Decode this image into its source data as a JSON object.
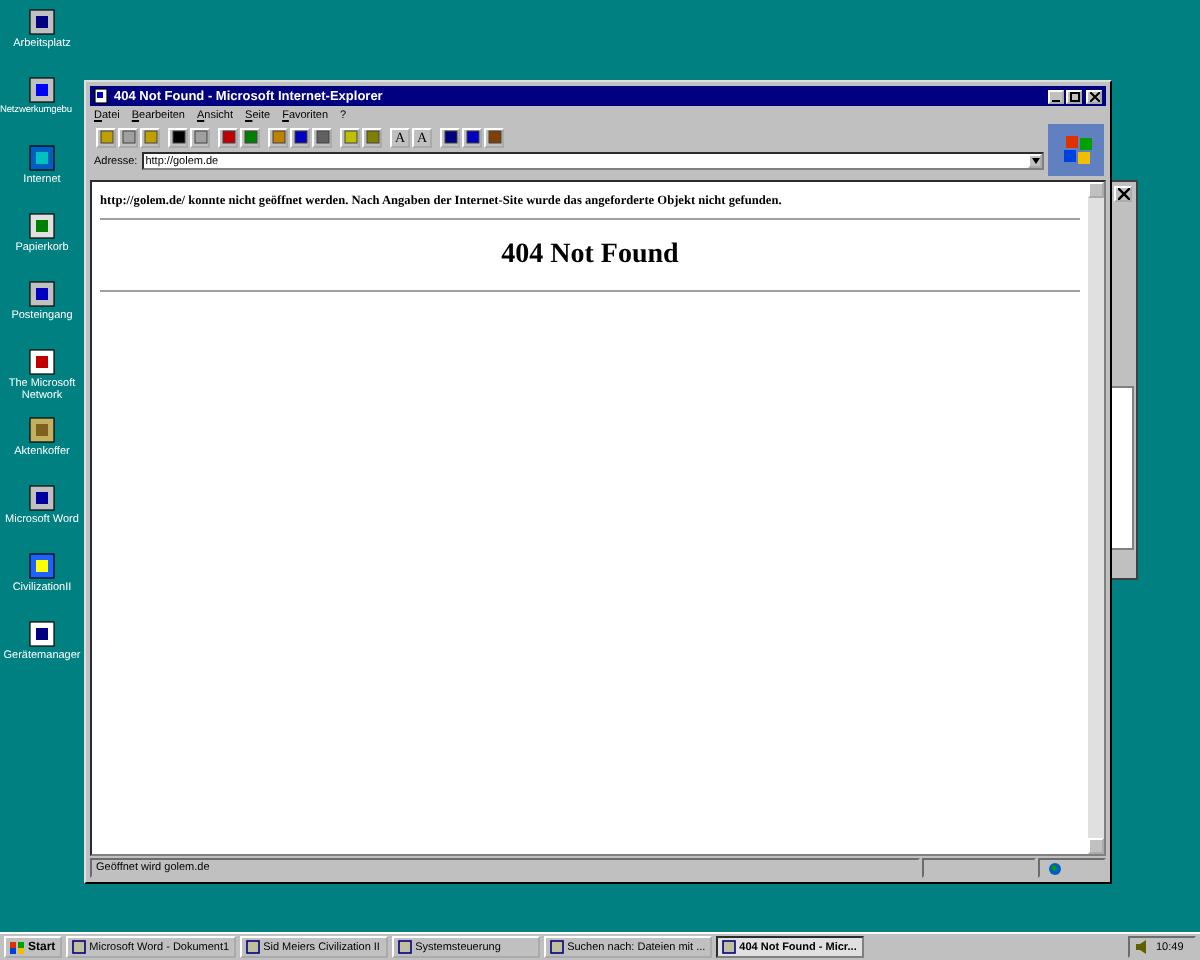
{
  "desktop_icons": [
    {
      "kind": "computer",
      "label": "Arbeitsplatz"
    },
    {
      "kind": "network",
      "label": "Netzwerkumgebu"
    },
    {
      "kind": "globe",
      "label": "Internet"
    },
    {
      "kind": "bin",
      "label": "Papierkorb"
    },
    {
      "kind": "inbox",
      "label": "Posteingang"
    },
    {
      "kind": "msn",
      "label": "The Microsoft Network"
    },
    {
      "kind": "briefcase",
      "label": "Aktenkoffer"
    },
    {
      "kind": "word",
      "label": "Microsoft Word"
    },
    {
      "kind": "civ",
      "label": "CivilizationII"
    },
    {
      "kind": "devices",
      "label": "Gerätemanager"
    }
  ],
  "window": {
    "title": "404 Not Found - Microsoft Internet-Explorer",
    "menu": [
      "Datei",
      "Bearbeiten",
      "Ansicht",
      "Seite",
      "Favoriten",
      "?"
    ],
    "toolbar": [
      {
        "kind": "open",
        "disabled": false
      },
      {
        "kind": "print",
        "disabled": true
      },
      {
        "kind": "mail",
        "disabled": false
      },
      {
        "kind": "back",
        "disabled": false
      },
      {
        "kind": "forward",
        "disabled": true
      },
      {
        "kind": "stop",
        "disabled": false
      },
      {
        "kind": "refresh",
        "disabled": false
      },
      {
        "kind": "home",
        "disabled": false
      },
      {
        "kind": "search",
        "disabled": false
      },
      {
        "kind": "gear",
        "disabled": false
      },
      {
        "kind": "folder",
        "disabled": false
      },
      {
        "kind": "favorites",
        "disabled": false
      },
      {
        "kind": "text",
        "label": "A",
        "disabled": false
      },
      {
        "kind": "text",
        "label": "A",
        "disabled": false
      },
      {
        "kind": "cut",
        "disabled": false
      },
      {
        "kind": "copy",
        "disabled": false
      },
      {
        "kind": "paste",
        "disabled": false
      }
    ],
    "address_label": "Adresse:",
    "address": "http://golem.de",
    "content": {
      "message": "http://golem.de/ konnte nicht geöffnet werden. Nach Angaben der Internet-Site wurde das angeforderte Objekt nicht gefunden.",
      "heading": "404 Not Found"
    },
    "status": "Geöffnet wird golem.de"
  },
  "taskbar": {
    "start": "Start",
    "tasks": [
      {
        "label": "Microsoft Word - Dokument1",
        "selected": false
      },
      {
        "label": "Sid Meiers Civilization II",
        "selected": false
      },
      {
        "label": "Systemsteuerung",
        "selected": false
      },
      {
        "label": "Suchen nach: Dateien mit ...",
        "selected": false
      },
      {
        "label": "404 Not Found - Micr...",
        "selected": true
      }
    ],
    "time": "10:49"
  }
}
